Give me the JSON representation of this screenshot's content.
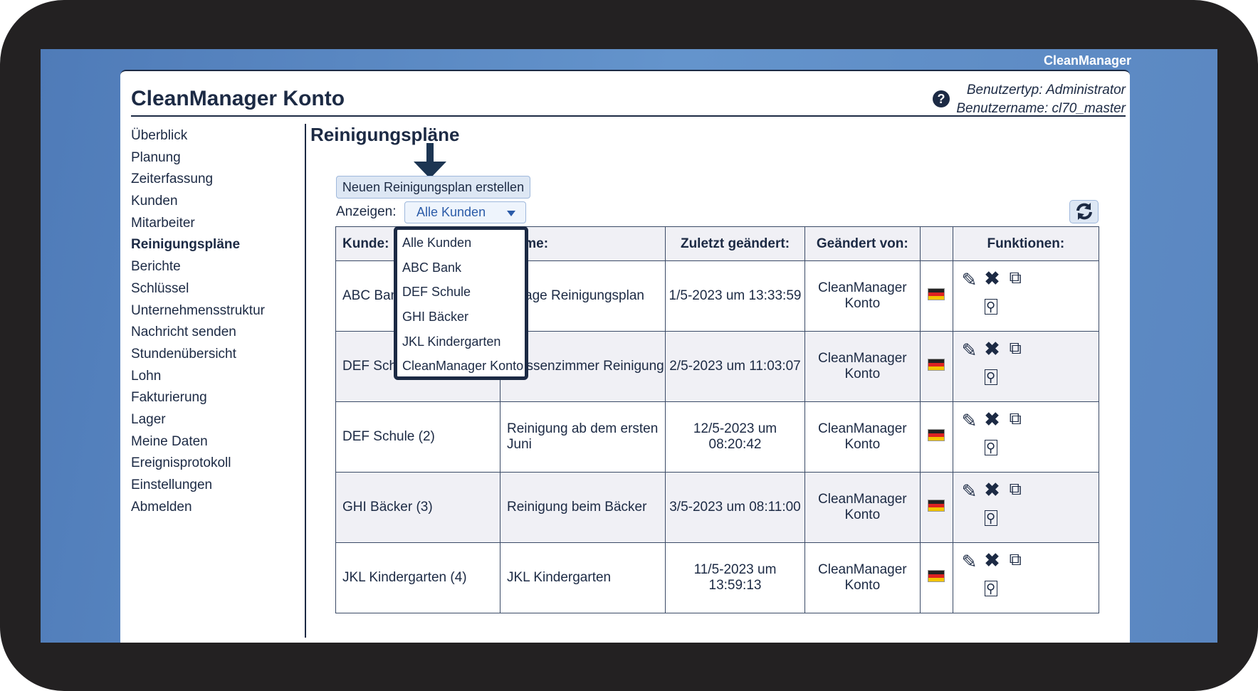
{
  "app_brand": "CleanManager",
  "header": {
    "title": "CleanManager Konto",
    "user_type": "Benutzertyp: Administrator",
    "user_name": "Benutzername: cl70_master"
  },
  "sidebar": {
    "items": [
      "Überblick",
      "Planung",
      "Zeiterfassung",
      "Kunden",
      "Mitarbeiter",
      "Reinigungspläne",
      "Berichte",
      "Schlüssel",
      "Unternehmensstruktur",
      "Nachricht senden",
      "Stundenübersicht",
      "Lohn",
      "Fakturierung",
      "Lager",
      "Meine Daten",
      "Ereignisprotokoll",
      "Einstellungen",
      "Abmelden"
    ],
    "active": "Reinigungspläne"
  },
  "main": {
    "heading": "Reinigungspläne",
    "new_button": "Neuen Reinigungsplan erstellen",
    "filter_label": "Anzeigen:",
    "filter_value": "Alle Kunden",
    "filter_options": [
      "Alle Kunden",
      "ABC Bank",
      "DEF Schule",
      "GHI Bäcker",
      "JKL Kindergarten",
      "CleanManager Konto"
    ],
    "table": {
      "headers": [
        "Kunde:",
        "Name:",
        "Zuletzt geändert:",
        "Geändert von:",
        "",
        "Funktionen:"
      ],
      "rows": [
        {
          "kunde": "ABC Bank",
          "name": "5 Tage Reinigungsplan",
          "changed": "1/5-2023 um 13:33:59",
          "by": "CleanManager Konto"
        },
        {
          "kunde": "DEF Schule",
          "name": "Klassenzimmer Reinigung",
          "changed": "2/5-2023 um 11:03:07",
          "by": "CleanManager Konto"
        },
        {
          "kunde": "DEF Schule (2)",
          "name": "Reinigung ab dem ersten Juni",
          "changed": "12/5-2023 um 08:20:42",
          "by": "CleanManager Konto"
        },
        {
          "kunde": "GHI Bäcker (3)",
          "name": "Reinigung beim Bäcker",
          "changed": "3/5-2023 um 08:11:00",
          "by": "CleanManager Konto"
        },
        {
          "kunde": "JKL Kindergarten (4)",
          "name": "JKL Kindergarten",
          "changed": "11/5-2023 um 13:59:13",
          "by": "CleanManager Konto"
        }
      ]
    }
  },
  "colors": {
    "accent": "#1c2a44",
    "background": "#5a86c0",
    "button": "#dde7f4"
  },
  "icons": [
    "help-icon",
    "refresh-icon",
    "edit-icon",
    "delete-icon",
    "copy-icon",
    "preview-icon",
    "german-flag-icon",
    "arrow-down-icon"
  ]
}
